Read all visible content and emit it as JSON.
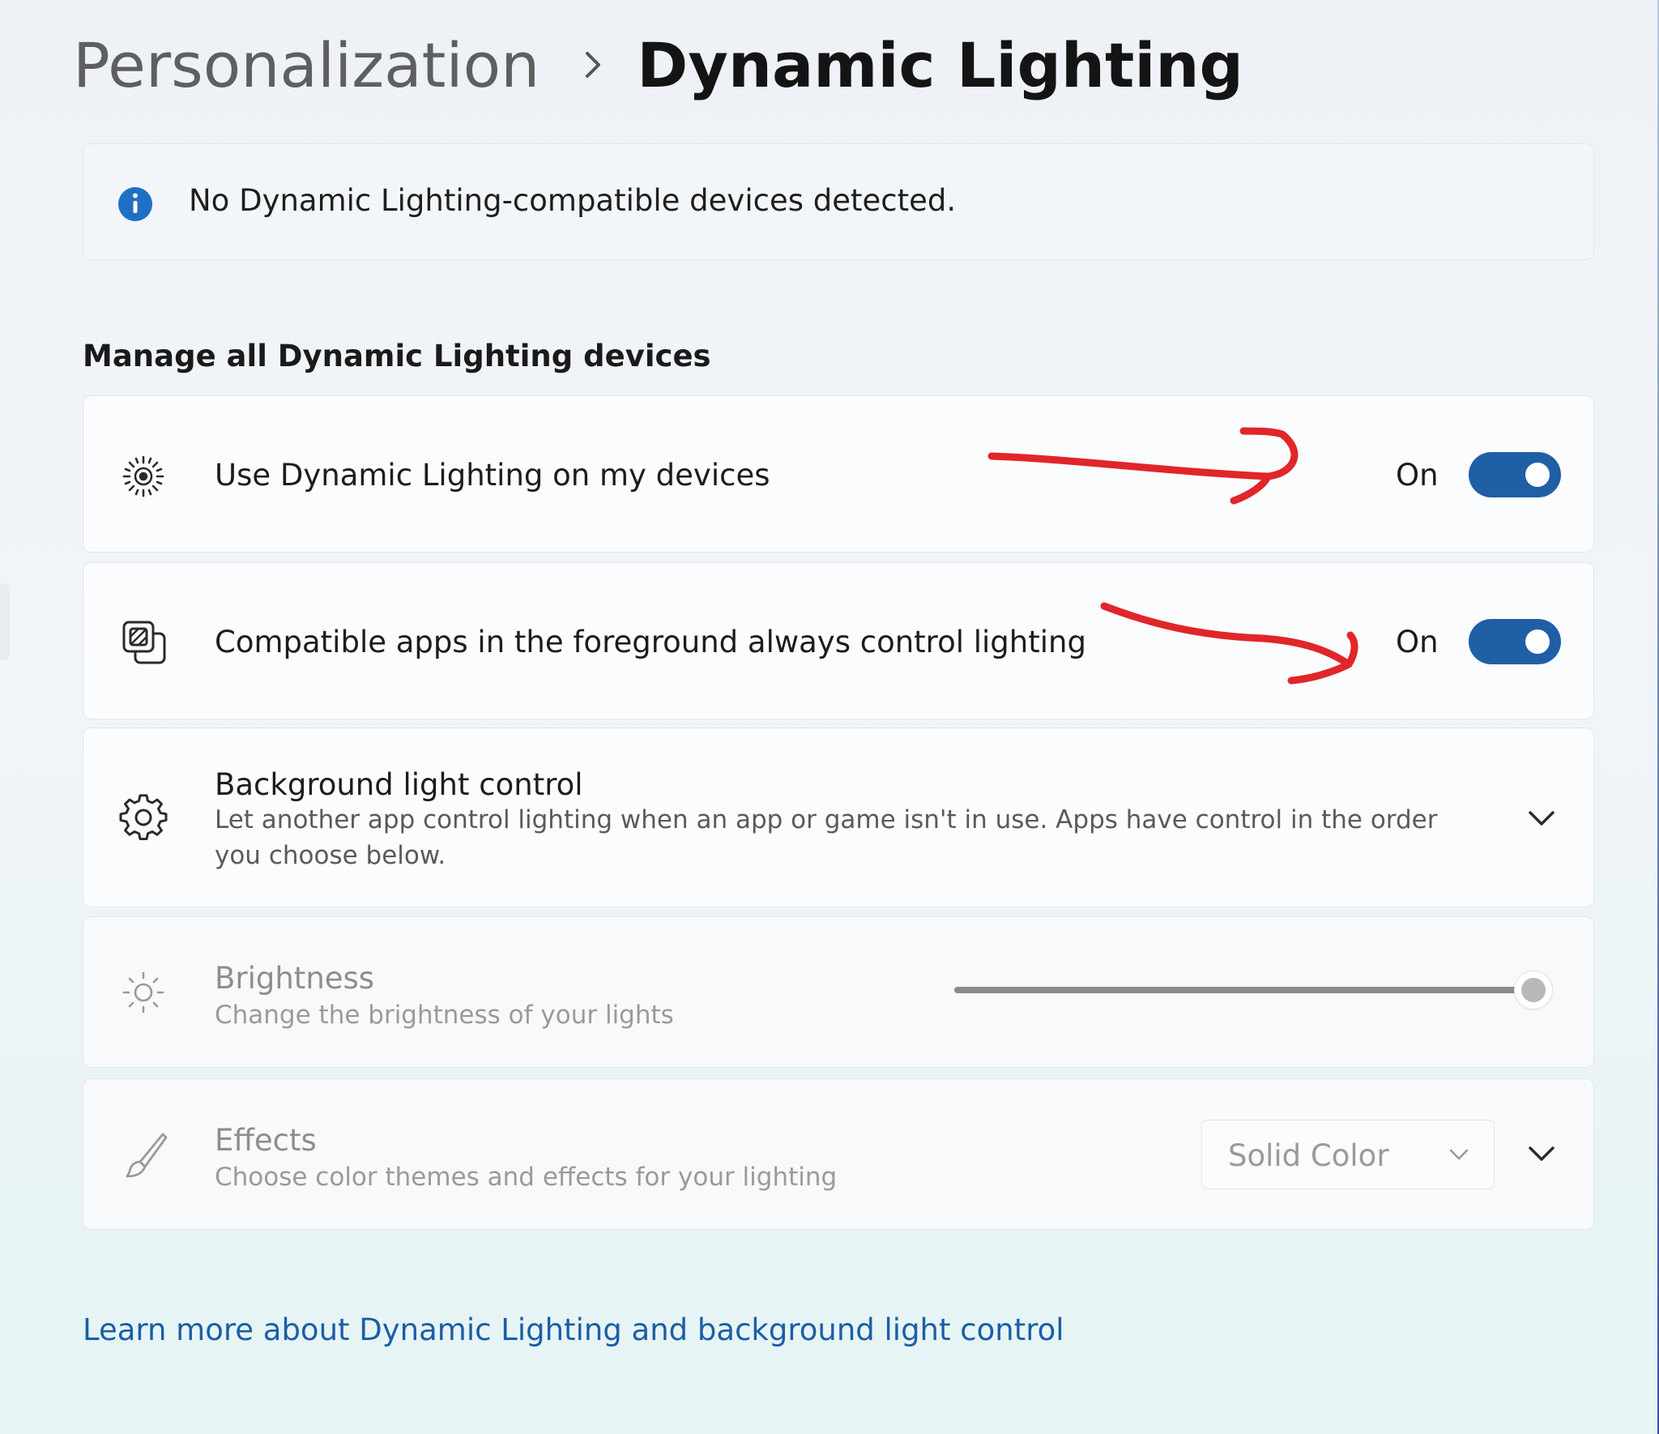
{
  "breadcrumb": {
    "parent": "Personalization",
    "current": "Dynamic Lighting"
  },
  "info_bar": {
    "icon": "info-icon",
    "text": "No Dynamic Lighting-compatible devices detected."
  },
  "section": {
    "title": "Manage all Dynamic Lighting devices"
  },
  "settings": [
    {
      "icon": "dynamic-lighting-icon",
      "label": "Use Dynamic Lighting on my devices",
      "state_text": "On",
      "toggle_on": true
    },
    {
      "icon": "foreground-apps-icon",
      "label": "Compatible apps in the foreground always control lighting",
      "state_text": "On",
      "toggle_on": true
    },
    {
      "icon": "gear-icon",
      "label": "Background light control",
      "description": "Let another app control lighting when an app or game isn't in use. Apps have control in the order you choose below.",
      "expandable": true
    },
    {
      "icon": "brightness-icon",
      "label": "Brightness",
      "description": "Change the brightness of your lights",
      "slider_value_percent": 100,
      "disabled": true
    },
    {
      "icon": "brush-icon",
      "label": "Effects",
      "description": "Choose color themes and effects for your lighting",
      "dropdown_value": "Solid Color",
      "disabled": true,
      "expandable": true
    }
  ],
  "learn_more": {
    "text": "Learn more about Dynamic Lighting and background light control"
  },
  "colors": {
    "accent": "#1f5fa6",
    "link": "#1a5ea8",
    "annotation_arrows": "#e0262a"
  }
}
